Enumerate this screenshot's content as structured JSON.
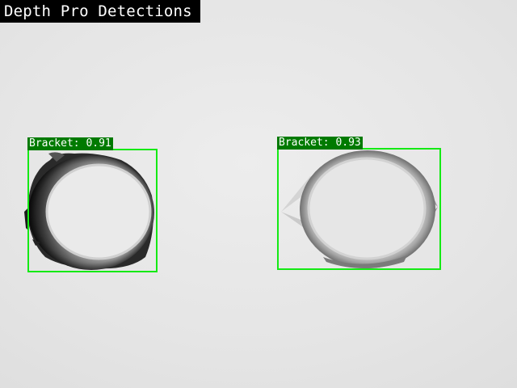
{
  "title": "Depth Pro Detections",
  "detections": [
    {
      "class_label": "Bracket",
      "score": "0.91",
      "label_text": "Bracket: 0.91"
    },
    {
      "class_label": "Bracket",
      "score": "0.93",
      "label_text": "Bracket: 0.93"
    }
  ],
  "colors": {
    "box": "#14ea14",
    "label_bg": "#007a00",
    "label_text": "#ffffff",
    "title_bg": "#000000",
    "title_text": "#ffffff"
  }
}
